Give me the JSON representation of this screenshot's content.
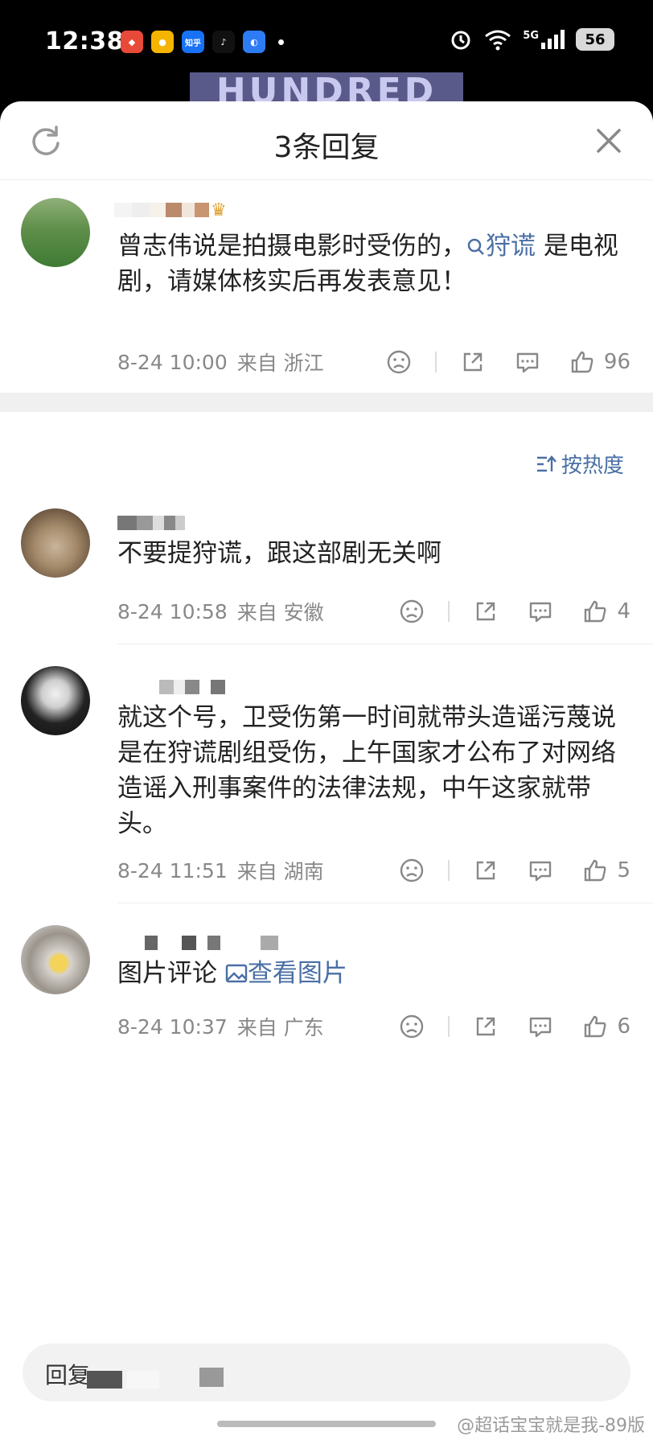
{
  "status_bar": {
    "time": "12:38",
    "apps": [
      "game",
      "weibo",
      "知乎",
      "tiktok",
      "browser"
    ],
    "signal": "5G",
    "battery": "56"
  },
  "peek_text": "HUNDRED",
  "sheet": {
    "title": "3条回复"
  },
  "main_comment": {
    "text_before_link": "曾志伟说是拍摄电影时受伤的，",
    "link_text": "狩谎",
    "text_after_link": " 是电视剧，请媒体核实后再发表意见！",
    "time": "8-24 10:00",
    "location": "来自 浙江",
    "likes": "96"
  },
  "sort_label": "按热度",
  "replies": [
    {
      "text": "不要提狩谎，跟这部剧无关啊",
      "time": "8-24 10:58",
      "location": "来自 安徽",
      "likes": "4"
    },
    {
      "text": "就这个号，卫受伤第一时间就带头造谣污蔑说是在狩谎剧组受伤，上午国家才公布了对网络造谣入刑事案件的法律法规，中午这家就带头。",
      "time": "8-24 11:51",
      "location": "来自 湖南",
      "likes": "5"
    },
    {
      "text": "图片评论",
      "link_text": "查看图片",
      "time": "8-24 10:37",
      "location": "来自 广东",
      "likes": "6"
    }
  ],
  "reply_input": {
    "placeholder": "回复"
  },
  "watermark": "@超话宝宝就是我-89版"
}
